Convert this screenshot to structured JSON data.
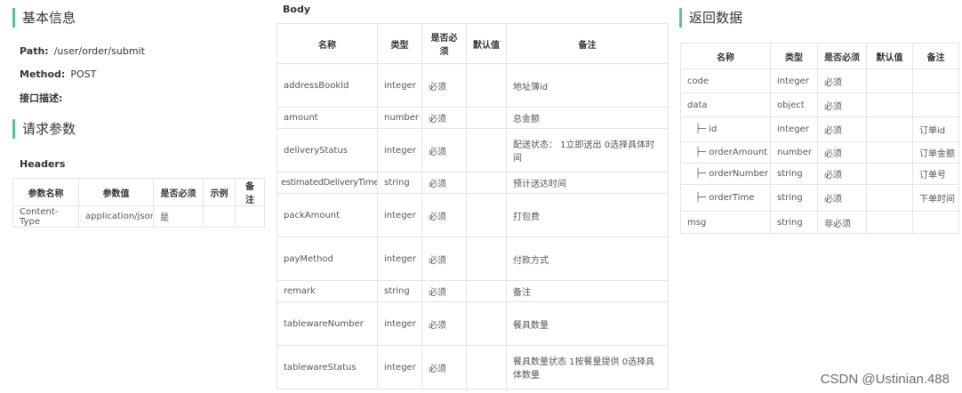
{
  "left": {
    "basic_info_title": "基本信息",
    "path_label": "Path:",
    "path_value": "/user/order/submit",
    "method_label": "Method:",
    "method_value": "POST",
    "desc_label": "接口描述:",
    "request_params_title": "请求参数",
    "headers_title": "Headers",
    "headers_table": {
      "columns": [
        "参数名称",
        "参数值",
        "是否必须",
        "示例",
        "备注"
      ],
      "rows": [
        [
          "Content-Type",
          "application/json",
          "是",
          "",
          ""
        ]
      ]
    }
  },
  "body": {
    "title": "Body",
    "columns": [
      "名称",
      "类型",
      "是否必须",
      "默认值",
      "备注"
    ],
    "rows": [
      [
        "addressBookId",
        "integer",
        "必须",
        "",
        "地址簿id"
      ],
      [
        "amount",
        "number",
        "必须",
        "",
        "总金额"
      ],
      [
        "deliveryStatus",
        "integer",
        "必须",
        "",
        "配送状态： 1立即送出 0选择具体时间"
      ],
      [
        "estimatedDeliveryTime",
        "string",
        "必须",
        "",
        "预计送达时间"
      ],
      [
        "packAmount",
        "integer",
        "必须",
        "",
        "打包费"
      ],
      [
        "payMethod",
        "integer",
        "必须",
        "",
        "付款方式"
      ],
      [
        "remark",
        "string",
        "必须",
        "",
        "备注"
      ],
      [
        "tablewareNumber",
        "integer",
        "必须",
        "",
        "餐具数量"
      ],
      [
        "tablewareStatus",
        "integer",
        "必须",
        "",
        "餐具数量状态 1按餐量提供 0选择具体数量"
      ]
    ]
  },
  "response": {
    "title": "返回数据",
    "columns": [
      "名称",
      "类型",
      "是否必须",
      "默认值",
      "备注"
    ],
    "rows": [
      [
        "code",
        "integer",
        "必须",
        "",
        ""
      ],
      [
        "data",
        "object",
        "必须",
        "",
        ""
      ],
      [
        "├─ id",
        "integer",
        "必须",
        "",
        "订单id"
      ],
      [
        "├─ orderAmount",
        "number",
        "必须",
        "",
        "订单金额"
      ],
      [
        "├─ orderNumber",
        "string",
        "必须",
        "",
        "订单号"
      ],
      [
        "├─ orderTime",
        "string",
        "必须",
        "",
        "下单时间"
      ],
      [
        "msg",
        "string",
        "非必须",
        "",
        ""
      ]
    ]
  },
  "watermark": "CSDN @Ustinian.488"
}
